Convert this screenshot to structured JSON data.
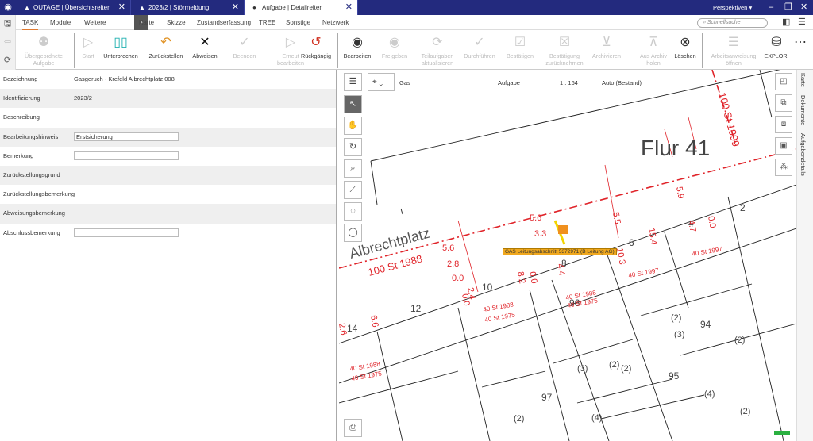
{
  "window": {
    "tabs": [
      {
        "label": "OUTAGE | Übersichtsreiter",
        "icon": "warning-icon"
      },
      {
        "label": "2023/2 | Störmeldung",
        "icon": "bell-icon"
      },
      {
        "label": "Aufgabe | Detailreiter",
        "icon": "dot-icon"
      }
    ],
    "perspectives": "Perspektiven ▾"
  },
  "menu": {
    "items": [
      "TASK",
      "Module",
      "Weitere"
    ],
    "more_items": [
      "Karte",
      "Skizze",
      "Zustandserfassung",
      "TREE",
      "Sonstige",
      "Netzwerk"
    ],
    "search_placeholder": "Schnellsuche"
  },
  "toolbar": {
    "buttons": [
      {
        "label": "Übergeordnete Aufgabe",
        "icon": "parent-task-icon",
        "enabled": false
      },
      {
        "label": "Start",
        "icon": "play-icon",
        "enabled": false
      },
      {
        "label": "Unterbrechen",
        "icon": "pause-icon",
        "enabled": true
      },
      {
        "label": "Zurückstellen",
        "icon": "undo-arrow-icon",
        "enabled": true
      },
      {
        "label": "Abweisen",
        "icon": "x-icon",
        "enabled": true
      },
      {
        "label": "Beenden",
        "icon": "check-icon",
        "enabled": false
      },
      {
        "label": "Erneut bearbeiten",
        "icon": "play-icon",
        "enabled": false
      },
      {
        "label": "Rückgängig",
        "icon": "revert-icon",
        "enabled": true
      },
      {
        "label": "Bearbeiten",
        "icon": "edit-icon",
        "enabled": true
      },
      {
        "label": "Freigeben",
        "icon": "release-icon",
        "enabled": false
      },
      {
        "label": "Teilaufgaben aktualisieren",
        "icon": "refresh-icon",
        "enabled": false
      },
      {
        "label": "Durchführen",
        "icon": "check-circle-icon",
        "enabled": false
      },
      {
        "label": "Bestätigen",
        "icon": "clipboard-check-icon",
        "enabled": false
      },
      {
        "label": "Bestätigung zurücknehmen",
        "icon": "clipboard-x-icon",
        "enabled": false
      },
      {
        "label": "Archivieren",
        "icon": "archive-icon",
        "enabled": false
      },
      {
        "label": "Aus Archiv holen",
        "icon": "unarchive-icon",
        "enabled": false
      },
      {
        "label": "Löschen",
        "icon": "delete-circle-icon",
        "enabled": true
      },
      {
        "label": "Arbeitsanweisung öffnen",
        "icon": "list-icon",
        "enabled": false
      },
      {
        "label": "EXPLORI",
        "icon": "database-search-icon",
        "enabled": true
      }
    ]
  },
  "form": {
    "rows": [
      {
        "label": "Bezeichnung",
        "value": "Gasgeruch - Krefeld Albrechtplatz 008"
      },
      {
        "label": "Identifizierung",
        "value": "2023/2"
      },
      {
        "label": "Beschreibung",
        "value": ""
      },
      {
        "label": "Bearbeitungshinweis",
        "input": "Erstsicherung"
      },
      {
        "label": "Bemerkung",
        "input": ""
      },
      {
        "label": "Zurückstellungsgrund",
        "value": ""
      },
      {
        "label": "Zurückstellungsbemerkung",
        "value": ""
      },
      {
        "label": "Abweisungsbemerkung",
        "value": ""
      },
      {
        "label": "Abschlussbemerkung",
        "input": ""
      }
    ]
  },
  "map": {
    "layer": "Gas",
    "mode": "Aufgabe",
    "scale": "1 : 164",
    "view": "Auto (Bestand)",
    "labels": {
      "flur": "Flur 41",
      "street": "Albrechtplatz",
      "main": "100 St 1988",
      "top": "100 St 1999",
      "tooltip": "GAS Leitungsabschnitt 5372971 (B Leitung AG)",
      "parcels": [
        "12",
        "10",
        "8",
        "6",
        "4",
        "2",
        "14",
        "97",
        "95",
        "94",
        "(3)",
        "(2)",
        "(2)",
        "(2)",
        "(2)",
        "(4)",
        "(4)",
        "(2)",
        "(3)",
        "(2)",
        "96"
      ],
      "pipes": [
        "40 St 1988",
        "40 St 1975",
        "40 St 1988",
        "40 St 1975",
        "40 St 1997",
        "40 St 1997",
        "40 St 1988",
        "40 St 1975"
      ],
      "dims": [
        "5.6",
        "2.8",
        "0.0",
        "5.6",
        "3.3",
        "0.0",
        "2.4",
        "0.0",
        "0.0",
        "8.2",
        "4.4",
        "10.3",
        "5.5",
        "5.9",
        "0.0",
        "4.7",
        "15.4",
        "6.6",
        "2.6"
      ]
    }
  },
  "vtabs": [
    "Karte",
    "Dokumente",
    "Aufgabendetails"
  ],
  "colors": {
    "titlebar": "#232a7e",
    "accent": "#e07a30",
    "map_red": "#e0242a"
  }
}
